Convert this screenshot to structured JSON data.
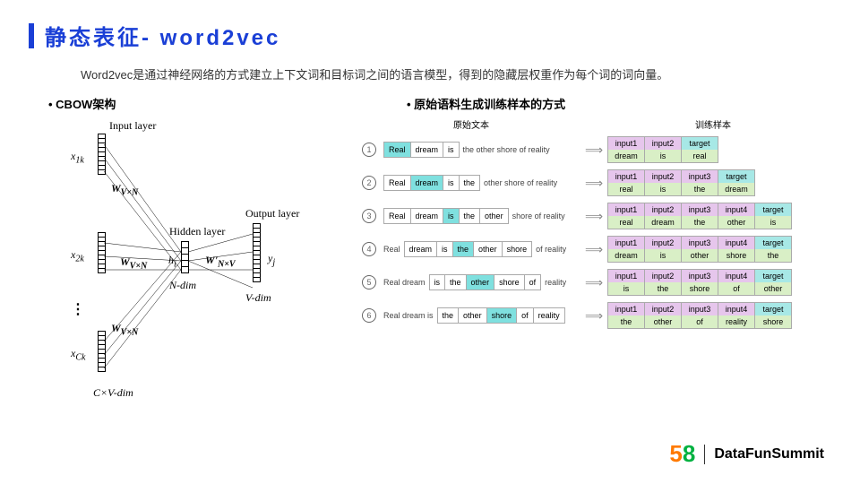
{
  "title": "静态表征- word2vec",
  "subtitle": "Word2vec是通过神经网络的方式建立上下文词和目标词之间的语言模型，得到的隐藏层权重作为每个词的词向量。",
  "left_header": "CBOW架构",
  "right_header": "原始语料生成训练样本的方式",
  "col_header_left": "原始文本",
  "col_header_right": "训练样本",
  "cbow": {
    "input_layer": "Input layer",
    "hidden_layer": "Hidden layer",
    "output_layer": "Output layer",
    "x1": "x",
    "x1_sub": "1k",
    "x2": "x",
    "x2_sub": "2k",
    "xc": "x",
    "xc_sub": "Ck",
    "w_in": "W",
    "w_in_sub": "V×N",
    "wp_out": "W'",
    "wp_out_sub": "N×V",
    "hi": "h",
    "hi_sub": "i",
    "yj": "y",
    "yj_sub": "j",
    "ndim": "N-dim",
    "vdim": "V-dim",
    "cvdim": "C×V-dim",
    "dots": "⋮"
  },
  "rows": [
    {
      "n": "1",
      "pre": "",
      "ctx": [
        "Real",
        "dream",
        "is"
      ],
      "hl": 0,
      "rest": "the other shore of reality",
      "inputs": [
        "input1",
        "input2"
      ],
      "target": "target",
      "vals": [
        "dream",
        "is"
      ],
      "tval": "real"
    },
    {
      "n": "2",
      "pre": "",
      "ctx": [
        "Real",
        "dream",
        "is",
        "the"
      ],
      "hl": 1,
      "rest": "other shore of reality",
      "inputs": [
        "input1",
        "input2",
        "input3"
      ],
      "target": "target",
      "vals": [
        "real",
        "is",
        "the"
      ],
      "tval": "dream"
    },
    {
      "n": "3",
      "pre": "",
      "ctx": [
        "Real",
        "dream",
        "is",
        "the",
        "other"
      ],
      "hl": 2,
      "rest": "shore of reality",
      "inputs": [
        "input1",
        "input2",
        "input3",
        "input4"
      ],
      "target": "target",
      "vals": [
        "real",
        "dream",
        "the",
        "other"
      ],
      "tval": "is"
    },
    {
      "n": "4",
      "pre": "Real",
      "ctx": [
        "dream",
        "is",
        "the",
        "other",
        "shore"
      ],
      "hl": 2,
      "rest": "of reality",
      "inputs": [
        "input1",
        "input2",
        "input3",
        "input4"
      ],
      "target": "target",
      "vals": [
        "dream",
        "is",
        "other",
        "shore"
      ],
      "tval": "the"
    },
    {
      "n": "5",
      "pre": "Real  dream",
      "ctx": [
        "is",
        "the",
        "other",
        "shore",
        "of"
      ],
      "hl": 2,
      "rest": "reality",
      "inputs": [
        "input1",
        "input2",
        "input3",
        "input4"
      ],
      "target": "target",
      "vals": [
        "is",
        "the",
        "shore",
        "of"
      ],
      "tval": "other"
    },
    {
      "n": "6",
      "pre": "Real  dream  is",
      "ctx": [
        "the",
        "other",
        "shore",
        "of",
        "reality"
      ],
      "hl": 2,
      "rest": "",
      "inputs": [
        "input1",
        "input2",
        "input3",
        "input4"
      ],
      "target": "target",
      "vals": [
        "the",
        "other",
        "of",
        "reality"
      ],
      "tval": "shore"
    }
  ],
  "footer": {
    "logo5": "5",
    "logo8": "8",
    "brand": "DataFunSummit"
  }
}
